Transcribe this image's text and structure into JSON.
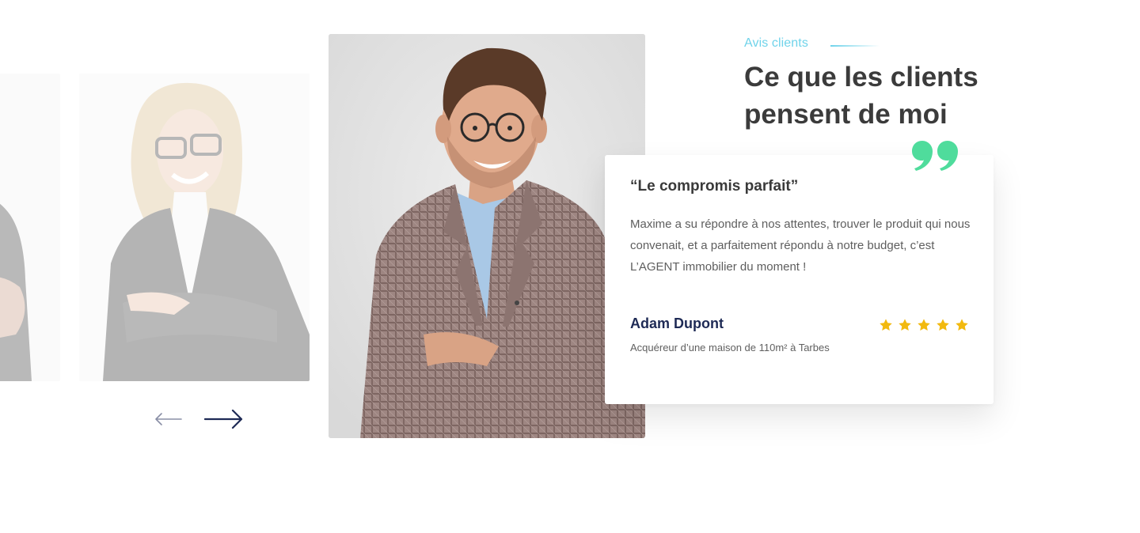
{
  "section": {
    "eyebrow": "Avis clients",
    "headline_line1": "Ce que les clients",
    "headline_line2": "pensent de moi"
  },
  "testimonial": {
    "title": "“Le compromis parfait”",
    "text": "Maxime a su répondre à nos attentes, trouver le produit qui nous convenait, et a parfaitement répondu à notre budget, c’est L’AGENT immobilier du moment !",
    "author_name": "Adam Dupont",
    "author_role": "Acquéreur d’une maison de 110m² à Tarbes",
    "rating": 5,
    "rating_max": 5
  },
  "navigation": {
    "prev_icon": "arrow-left-icon",
    "next_icon": "arrow-right-icon"
  },
  "colors": {
    "accent_cyan": "#6fd3ea",
    "quote_green": "#4fdc9c",
    "star_yellow": "#f2b90f",
    "navy": "#1e2a55",
    "headline": "#3b3b3b"
  }
}
